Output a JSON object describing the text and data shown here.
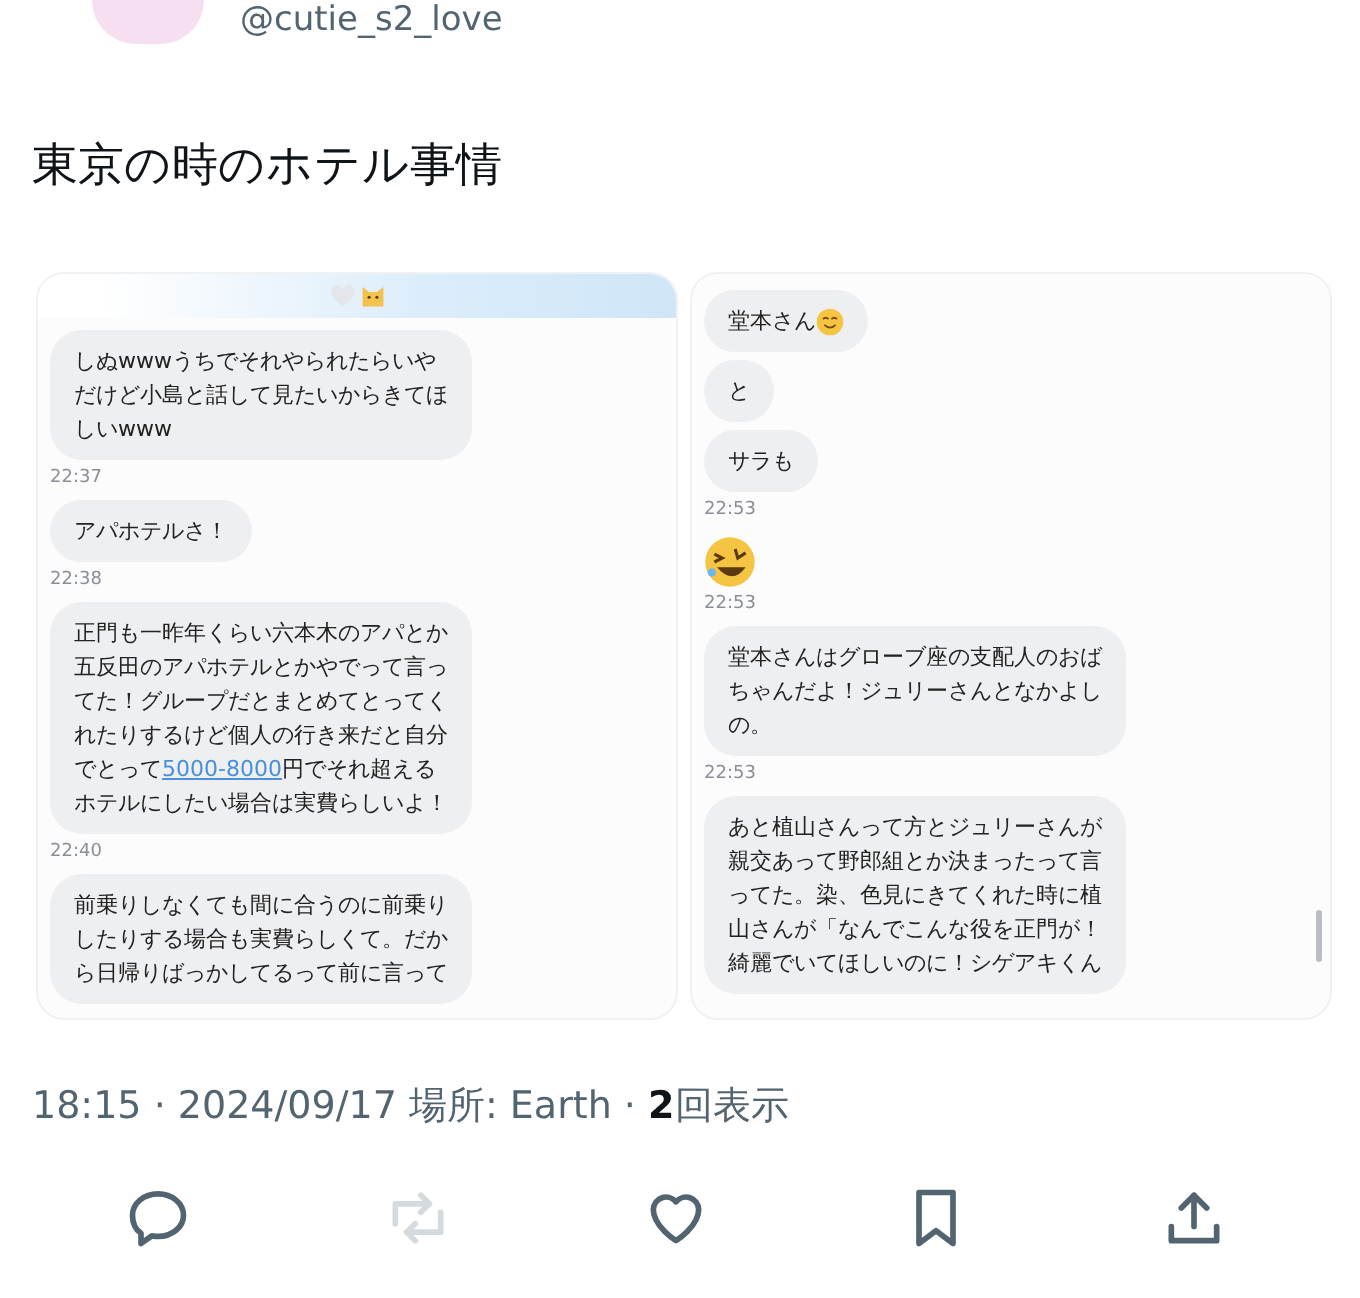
{
  "author": {
    "handle": "@cutie_s2_love"
  },
  "tweet": {
    "text": "東京の時のホテル事情"
  },
  "images": [
    {
      "banner": true,
      "items": [
        {
          "kind": "message",
          "lines": [
            "しぬwwwうちでそれやられたらいや",
            "だけど小島と話して見たいからきてほ",
            "しいwww"
          ]
        },
        {
          "kind": "time",
          "text": "22:37"
        },
        {
          "kind": "message",
          "lines": [
            "アパホテルさ！"
          ]
        },
        {
          "kind": "time",
          "text": "22:38"
        },
        {
          "kind": "message",
          "lines": [
            "正門も一昨年くらい六本木のアパとか",
            "五反田のアパホテルとかやでって言っ",
            "てた！グループだとまとめてとってく",
            "れたりするけど個人の行き来だと自分",
            {
              "text": "でとって",
              "link": "5000-8000",
              "after": "円でそれ超える"
            },
            "ホテルにしたい場合は実費らしいよ！"
          ]
        },
        {
          "kind": "time",
          "text": "22:40"
        },
        {
          "kind": "message",
          "lines": [
            "前乗りしなくても間に合うのに前乗り",
            "したりする場合も実費らしくて。だか",
            "ら日帰りばっかしてるって前に言って"
          ]
        }
      ],
      "scrollbar": false
    },
    {
      "banner": false,
      "items": [
        {
          "kind": "message",
          "lines": [
            "堂本さん"
          ],
          "emoji": true
        },
        {
          "kind": "message",
          "lines": [
            "と"
          ]
        },
        {
          "kind": "message",
          "lines": [
            "サラも"
          ]
        },
        {
          "kind": "time",
          "text": "22:53"
        },
        {
          "kind": "emoji"
        },
        {
          "kind": "time",
          "text": "22:53"
        },
        {
          "kind": "message",
          "lines": [
            "堂本さんはグローブ座の支配人のおば",
            "ちゃんだよ！ジュリーさんとなかよし",
            "の。"
          ]
        },
        {
          "kind": "time",
          "text": "22:53"
        },
        {
          "kind": "message",
          "lines": [
            "あと植山さんって方とジュリーさんが",
            "親交あって野郎組とか決まったって言",
            "ってた。染、色見にきてくれた時に植",
            "山さんが「なんでこんな役を正門が！",
            "綺麗でいてほしいのに！シゲアキくん"
          ]
        }
      ],
      "scrollbar": true
    }
  ],
  "meta": {
    "time": "18:15",
    "separator_1": "·",
    "date": "2024/09/17",
    "location_label": "場所:",
    "location": "Earth",
    "separator_2": "·",
    "views": "2",
    "views_label": "回表示"
  },
  "actions": [
    {
      "kind": "reply",
      "disabled": false
    },
    {
      "kind": "repost",
      "disabled": true
    },
    {
      "kind": "like",
      "disabled": false
    },
    {
      "kind": "bookmark",
      "disabled": false
    },
    {
      "kind": "share",
      "disabled": false
    }
  ]
}
